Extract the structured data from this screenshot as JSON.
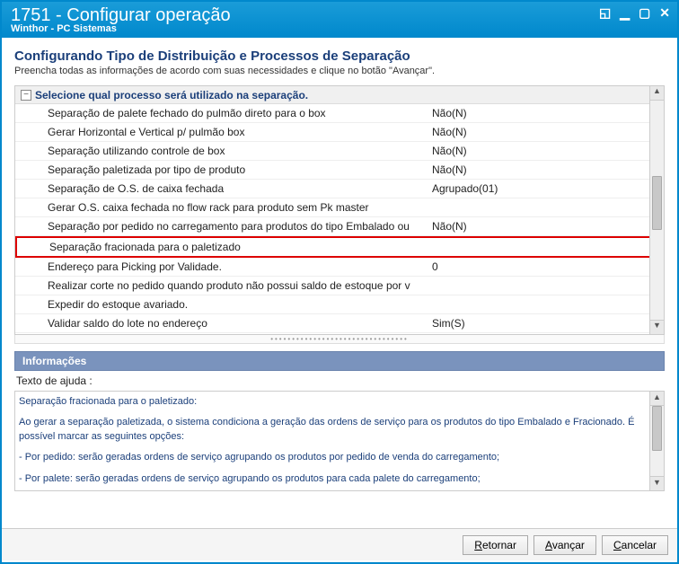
{
  "window": {
    "title": "1751 - Configurar operação",
    "subtitle": "Winthor - PC Sistemas"
  },
  "header": {
    "title": "Configurando Tipo de Distribuição e Processos de Separação",
    "subtitle": "Preencha todas as informações de acordo com suas necessidades e clique no botão \"Avançar\"."
  },
  "grid": {
    "group_label": "Selecione qual processo será utilizado na separação.",
    "rows": [
      {
        "label": "Separação de palete fechado do pulmão direto para o box",
        "value": "Não(N)"
      },
      {
        "label": "Gerar Horizontal e Vertical p/ pulmão box",
        "value": "Não(N)"
      },
      {
        "label": "Separação utilizando controle de box",
        "value": "Não(N)"
      },
      {
        "label": "Separação paletizada por tipo de produto",
        "value": "Não(N)"
      },
      {
        "label": "Separação de O.S. de caixa fechada",
        "value": "Agrupado(01)"
      },
      {
        "label": "Gerar O.S. caixa fechada no flow rack para produto sem Pk master",
        "value": ""
      },
      {
        "label": "Separação por pedido no carregamento para produtos do tipo Embalado ou",
        "value": "Não(N)"
      },
      {
        "label": "Separação fracionada para o paletizado",
        "value": "",
        "highlighted": true
      },
      {
        "label": "Endereço para Picking por Validade.",
        "value": "0"
      },
      {
        "label": "Realizar corte no pedido quando produto não possui saldo de estoque por v",
        "value": ""
      },
      {
        "label": "Expedir do estoque avariado.",
        "value": ""
      },
      {
        "label": "Validar saldo do lote no endereço",
        "value": "Sim(S)"
      }
    ]
  },
  "info": {
    "panel_title": "Informações",
    "subheader": "Texto de ajuda :",
    "help_title": "Separação fracionada para o paletizado:",
    "help_p1": "Ao gerar a separação paletizada, o sistema condiciona a geração das ordens de serviço para os produtos do tipo Embalado e Fracionado. É possível marcar as seguintes opções:",
    "help_p2": "- Por pedido: serão geradas ordens de serviço agrupando os produtos por pedido de venda do carregamento;",
    "help_p3": "- Por palete: serão geradas ordens de serviço agrupando os produtos para cada palete do carregamento;"
  },
  "footer": {
    "back": "Retornar",
    "next": "Avançar",
    "cancel": "Cancelar"
  }
}
